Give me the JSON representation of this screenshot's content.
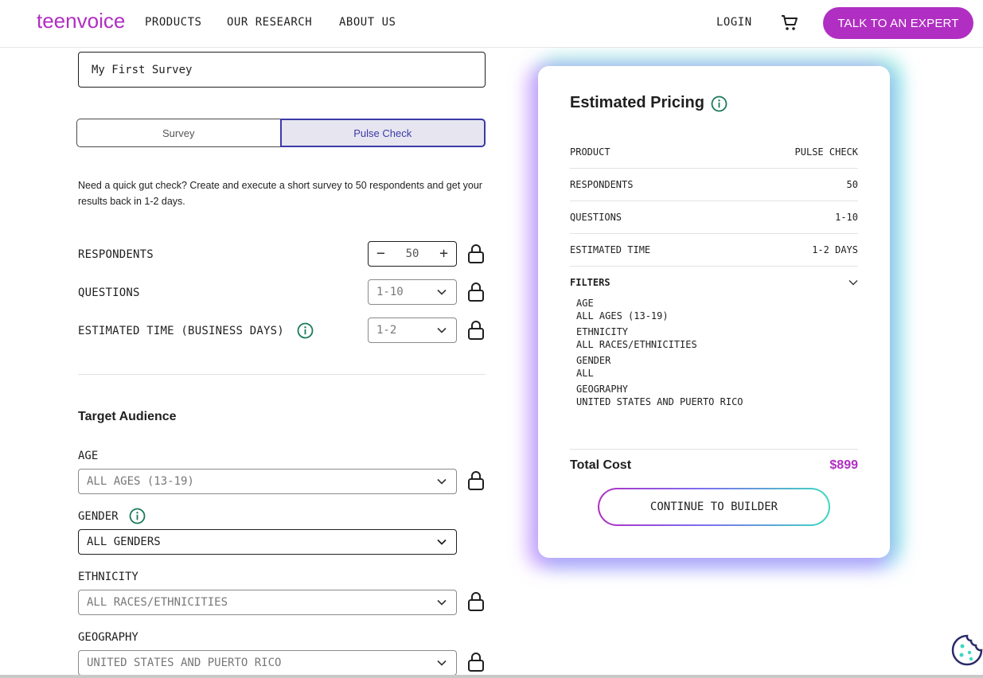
{
  "header": {
    "logo_text": "teenvoice",
    "nav": [
      "PRODUCTS",
      "OUR RESEARCH",
      "ABOUT US"
    ],
    "login": "LOGIN",
    "cart_icon": "shopping-cart-icon",
    "cta": "TALK TO AN EXPERT"
  },
  "colors": {
    "brand": "#b02fc2",
    "toggle_active": "#3d3aa8",
    "info_icon": "#1a7a5a"
  },
  "form": {
    "survey_name_value": "My First Survey",
    "toggle": {
      "options": [
        "Survey",
        "Pulse Check"
      ],
      "selected": "Pulse Check"
    },
    "description": "Need a quick gut check? Create and execute a short survey to 50 respondents and get your results back in 1-2 days.",
    "respondents": {
      "label": "RESPONDENTS",
      "value": "50",
      "minus": "−",
      "plus": "+"
    },
    "questions": {
      "label": "QUESTIONS",
      "value": "1-10"
    },
    "estimated_time": {
      "label": "ESTIMATED TIME (BUSINESS DAYS)",
      "value": "1-2"
    }
  },
  "audience": {
    "title": "Target Audience",
    "age": {
      "label": "AGE",
      "value": "ALL AGES (13-19)"
    },
    "gender": {
      "label": "GENDER",
      "value": "ALL GENDERS"
    },
    "ethnicity": {
      "label": "ETHNICITY",
      "value": "ALL RACES/ETHNICITIES"
    },
    "geography": {
      "label": "GEOGRAPHY",
      "value": "UNITED STATES AND PUERTO RICO"
    }
  },
  "pricing": {
    "title": "Estimated Pricing",
    "rows": [
      {
        "label": "PRODUCT",
        "value": "PULSE CHECK"
      },
      {
        "label": "RESPONDENTS",
        "value": "50"
      },
      {
        "label": "QUESTIONS",
        "value": "1-10"
      },
      {
        "label": "ESTIMATED TIME",
        "value": "1-2 DAYS"
      }
    ],
    "filters_label": "FILTERS",
    "filters": [
      {
        "name": "AGE",
        "value": "ALL AGES (13-19)"
      },
      {
        "name": "ETHNICITY",
        "value": "ALL RACES/ETHNICITIES"
      },
      {
        "name": "GENDER",
        "value": "ALL"
      },
      {
        "name": "GEOGRAPHY",
        "value": "UNITED STATES AND PUERTO RICO"
      }
    ],
    "total_label": "Total Cost",
    "total_value": "$899",
    "continue": "CONTINUE TO BUILDER"
  }
}
